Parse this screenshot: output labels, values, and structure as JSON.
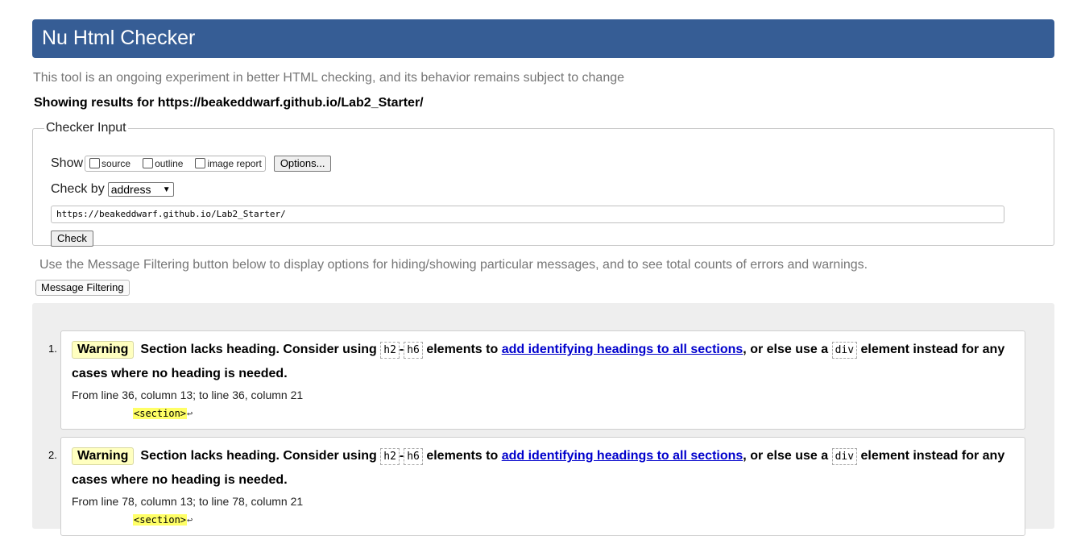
{
  "header": {
    "title": "Nu Html Checker"
  },
  "subtitle": "This tool is an ongoing experiment in better HTML checking, and its behavior remains subject to change",
  "showing": "Showing results for https://beakeddwarf.github.io/Lab2_Starter/",
  "checker_input": {
    "legend": "Checker Input",
    "show_label": "Show",
    "show_options": [
      "source",
      "outline",
      "image report"
    ],
    "options_button": "Options...",
    "check_by_label": "Check by",
    "check_by_value": "address",
    "url_value": "https://beakeddwarf.github.io/Lab2_Starter/",
    "check_button": "Check"
  },
  "filter": {
    "note": "Use the Message Filtering button below to display options for hiding/showing particular messages, and to see total counts of errors and warnings.",
    "button": "Message Filtering"
  },
  "messages": [
    {
      "num": "1.",
      "type": "Warning",
      "t1": "Section lacks heading. Consider using ",
      "code1": "h2",
      "dash": "-",
      "code2": "h6",
      "t2": " elements to ",
      "link": "add identifying headings to all sections",
      "t3": ", or else use a ",
      "code3": "div",
      "t4": " element instead for any cases where no heading is needed.",
      "location": "From line 36, column 13; to line 36, column 21",
      "extract": "<section>",
      "extract_lf": "↩"
    },
    {
      "num": "2.",
      "type": "Warning",
      "t1": "Section lacks heading. Consider using ",
      "code1": "h2",
      "dash": "-",
      "code2": "h6",
      "t2": " elements to ",
      "link": "add identifying headings to all sections",
      "t3": ", or else use a ",
      "code3": "div",
      "t4": " element instead for any cases where no heading is needed.",
      "location": "From line 78, column 13; to line 78, column 21",
      "extract": "<section>",
      "extract_lf": "↩"
    }
  ]
}
